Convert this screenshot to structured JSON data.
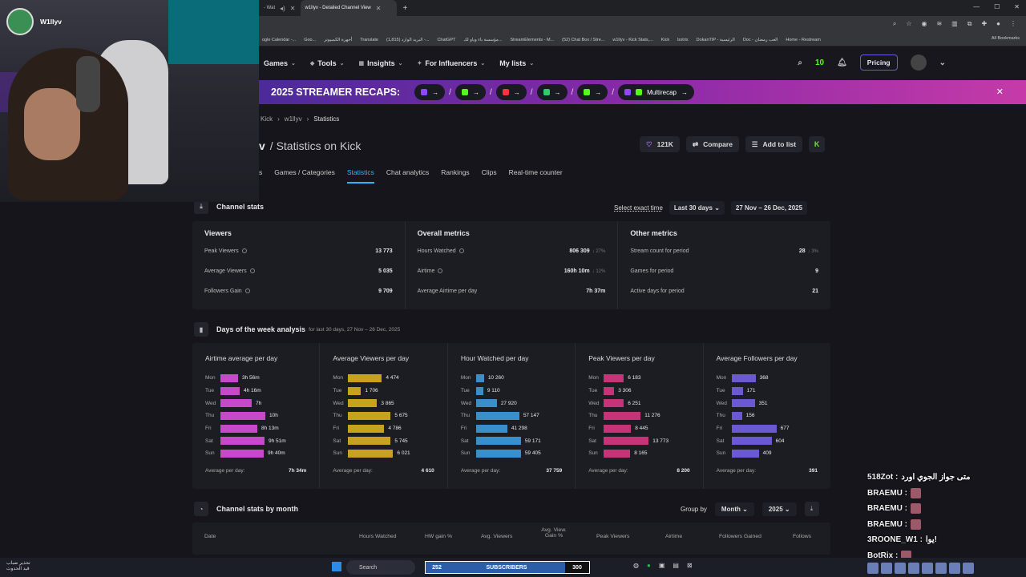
{
  "browser": {
    "tabs": [
      {
        "label": "- Wat",
        "active": false
      },
      {
        "label": "w1llyv - Detailed Channel View",
        "active": true
      }
    ],
    "bookmarks": [
      "ogle Calendar -...",
      "Goo...",
      "أجهزة الكمبيوتر",
      "Translate",
      "(1,815) البريد الوارد -...",
      "ChatGPT",
      "مؤسسة باء وياو لك...",
      "StreamElements - M...",
      "(52) Chat Box / Stre...",
      "w1llyv - Kick Stats,...",
      "Kick",
      "botrix",
      "DokanTIP - الرئيسية",
      "Doc - العب رمضان",
      "Home - Restream"
    ],
    "all_bookmarks": "All Bookmarks"
  },
  "nav": {
    "items": [
      "Games",
      "Tools",
      "Insights",
      "For Influencers",
      "My lists"
    ],
    "pricing": "Pricing",
    "badge_green": "10",
    "badge_alert": "3"
  },
  "banner": {
    "title": "2025 STREAMER RECAPS:",
    "multi": "Multirecap",
    "slash": "/",
    "pills": [
      {
        "label": "",
        "color": "#9146ff"
      },
      {
        "label": "",
        "color": "#53fc18"
      },
      {
        "label": "",
        "color": "#ff3040"
      },
      {
        "label": "",
        "color": "#2ecc71"
      },
      {
        "label": "",
        "color": "#53fc18"
      }
    ]
  },
  "crumbs": [
    "Kick",
    "w1llyv",
    "Statistics"
  ],
  "title": {
    "name": "v",
    "suffix": "/ Statistics on Kick"
  },
  "actions": {
    "likes": "121K",
    "compare": "Compare",
    "add": "Add to list",
    "kick": "K"
  },
  "tabs": [
    "s",
    "Games / Categories",
    "Statistics",
    "Chat analytics",
    "Rankings",
    "Clips",
    "Real-time counter"
  ],
  "channel_stats": {
    "heading": "Channel stats",
    "select_time": "Select exact time",
    "range": "Last 30 days",
    "dates": "27 Nov – 26 Dec, 2025",
    "viewers": {
      "heading": "Viewers",
      "rows": [
        {
          "label": "Peak Viewers",
          "value": "13 773",
          "delta": ""
        },
        {
          "label": "Average Viewers",
          "value": "5 035",
          "delta": ""
        },
        {
          "label": "Followers Gain",
          "value": "9 709",
          "delta": ""
        }
      ]
    },
    "overall": {
      "heading": "Overall metrics",
      "rows": [
        {
          "label": "Hours Watched",
          "value": "806 309",
          "delta": "↓ 27%"
        },
        {
          "label": "Airtime",
          "value": "160h 10m",
          "delta": "↓ 12%"
        },
        {
          "label": "Average Airtime per day",
          "value": "7h 37m",
          "delta": ""
        }
      ]
    },
    "other": {
      "heading": "Other metrics",
      "rows": [
        {
          "label": "Stream count for period",
          "value": "28",
          "delta": "↓ 3%"
        },
        {
          "label": "Games for period",
          "value": "9",
          "delta": ""
        },
        {
          "label": "Active days for period",
          "value": "21",
          "delta": ""
        }
      ]
    }
  },
  "week": {
    "heading": "Days of the week analysis",
    "sub": "for last 30 days, 27 Nov – 26 Dec, 2025",
    "avg_label": "Average per day:",
    "days": [
      "Mon",
      "Tue",
      "Wed",
      "Thu",
      "Fri",
      "Sat",
      "Sun"
    ],
    "panels": [
      {
        "title": "Airtime average per day",
        "color": "#c54ac8",
        "labels": [
          "3h 56m",
          "4h 16m",
          "7h",
          "10h",
          "8h 13m",
          "9h 51m",
          "9h 40m"
        ],
        "values": [
          236,
          256,
          420,
          600,
          493,
          591,
          580
        ],
        "max": 600,
        "avg": "7h 34m"
      },
      {
        "title": "Average Viewers per day",
        "color": "#c9a21d",
        "labels": [
          "4 474",
          "1 706",
          "3 865",
          "5 675",
          "4 786",
          "5 745",
          "6 021"
        ],
        "values": [
          4474,
          1706,
          3865,
          5675,
          4786,
          5745,
          6021
        ],
        "max": 6021,
        "avg": "4 610"
      },
      {
        "title": "Hour Watched per day",
        "color": "#3a8ec9",
        "labels": [
          "10 260",
          "9 110",
          "27 920",
          "57 147",
          "41 298",
          "59 171",
          "59 405"
        ],
        "values": [
          10260,
          9110,
          27920,
          57147,
          41298,
          59171,
          59405
        ],
        "max": 59405,
        "avg": "37 759"
      },
      {
        "title": "Peak Viewers per day",
        "color": "#c43578",
        "labels": [
          "6 183",
          "3 306",
          "6 251",
          "11 276",
          "8 445",
          "13 773",
          "8 165"
        ],
        "values": [
          6183,
          3306,
          6251,
          11276,
          8445,
          13773,
          8165
        ],
        "max": 13773,
        "avg": "8 200"
      },
      {
        "title": "Average Followers per day",
        "color": "#6a5ad0",
        "labels": [
          "368",
          "171",
          "351",
          "156",
          "677",
          "604",
          "409"
        ],
        "values": [
          368,
          171,
          351,
          156,
          677,
          604,
          409
        ],
        "max": 677,
        "avg": "391"
      }
    ]
  },
  "by_month": {
    "heading": "Channel stats by month",
    "group_by": "Group by",
    "month": "Month",
    "year": "2025",
    "columns": [
      "Date",
      "Hours Watched",
      "HW gain %",
      "Avg. Viewers",
      "Avg. View. Gain %",
      "Peak Viewers",
      "Airtime",
      "Followers Gained",
      "Follows"
    ]
  },
  "streamer": {
    "name": "W1llyv"
  },
  "chat": [
    {
      "name": "518Zot :",
      "text": "متى جواز الجوي اورد"
    },
    {
      "name": "BRAEMU :",
      "text": ""
    },
    {
      "name": "BRAEMU :",
      "text": ""
    },
    {
      "name": "BRAEMU :",
      "text": ""
    },
    {
      "name": "3ROONE_W1 :",
      "text": "يوا!"
    },
    {
      "name": "BotRix :",
      "text": ""
    }
  ],
  "taskbar": {
    "left_line1": "تحذير ضباب",
    "left_line2": "قيد الحدوث",
    "search": "Search",
    "subs_count": "252",
    "subs_label": "SUBSCRIBERS",
    "subs_goal": "300"
  }
}
